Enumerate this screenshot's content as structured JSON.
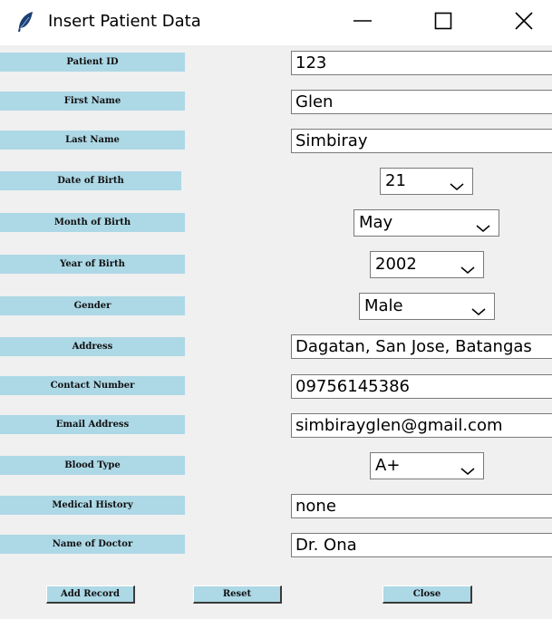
{
  "window": {
    "title": "Insert Patient Data",
    "icon": "feather-icon",
    "controls": [
      "minimize-icon",
      "maximize-icon",
      "close-icon"
    ]
  },
  "form": {
    "fields": [
      {
        "label": "Patient ID",
        "value": "123"
      },
      {
        "label": "First Name",
        "value": "Glen"
      },
      {
        "label": "Last Name",
        "value": "Simbiray"
      },
      {
        "label": "Date of Birth",
        "value": "21"
      },
      {
        "label": "Month of Birth",
        "value": "May"
      },
      {
        "label": "Year of Birth",
        "value": "2002"
      },
      {
        "label": "Gender",
        "value": "Male"
      },
      {
        "label": "Address",
        "value": "Dagatan, San Jose, Batangas"
      },
      {
        "label": "Contact Number",
        "value": "09756145386"
      },
      {
        "label": "Email Address",
        "value": "simbirayglen@gmail.com"
      },
      {
        "label": "Blood Type",
        "value": "A+"
      },
      {
        "label": "Medical History",
        "value": "none"
      },
      {
        "label": "Name of Doctor",
        "value": "Dr. Ona"
      }
    ]
  },
  "buttons": {
    "add_record": "Add Record",
    "reset": "Reset",
    "close": "Close"
  },
  "colors": {
    "label_background": "#add8e6",
    "window_background": "#f0f0f0"
  }
}
